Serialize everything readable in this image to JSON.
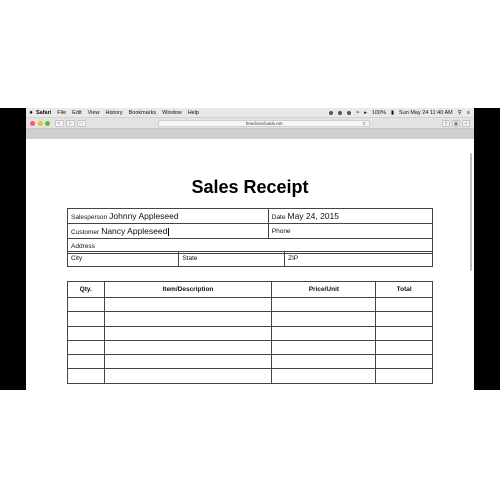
{
  "menubar": {
    "apple": "",
    "items": [
      "Safari",
      "File",
      "Edit",
      "View",
      "History",
      "Bookmarks",
      "Window",
      "Help"
    ],
    "battery": "100%",
    "clock": "Sun May 24  11:40 AM"
  },
  "toolbar": {
    "url": "freedownloads.net",
    "back": "<",
    "forward": ">",
    "reload": "C",
    "colors": {
      "close": "#fc5b57",
      "minimize": "#e5bf3c",
      "zoom": "#57c038"
    }
  },
  "document": {
    "title": "Sales Receipt",
    "salesperson": {
      "label": "Salesperson",
      "value": "Johnny Appleseed"
    },
    "date": {
      "label": "Date",
      "value": "May 24, 2015"
    },
    "customer": {
      "label": "Customer",
      "value": "Nancy Appleseed"
    },
    "phone": {
      "label": "Phone"
    },
    "address": {
      "label": "Address"
    },
    "city": {
      "label": "City"
    },
    "state": {
      "label": "State"
    },
    "zip": {
      "label": "ZIP"
    },
    "columns": [
      "Qty.",
      "Item/Description",
      "Price/Unit",
      "Total"
    ],
    "rows": [
      [
        "",
        "",
        "",
        ""
      ],
      [
        "",
        "",
        "",
        ""
      ],
      [
        "",
        "",
        "",
        ""
      ],
      [
        "",
        "",
        "",
        ""
      ],
      [
        "",
        "",
        "",
        ""
      ],
      [
        "",
        "",
        "",
        ""
      ]
    ]
  }
}
